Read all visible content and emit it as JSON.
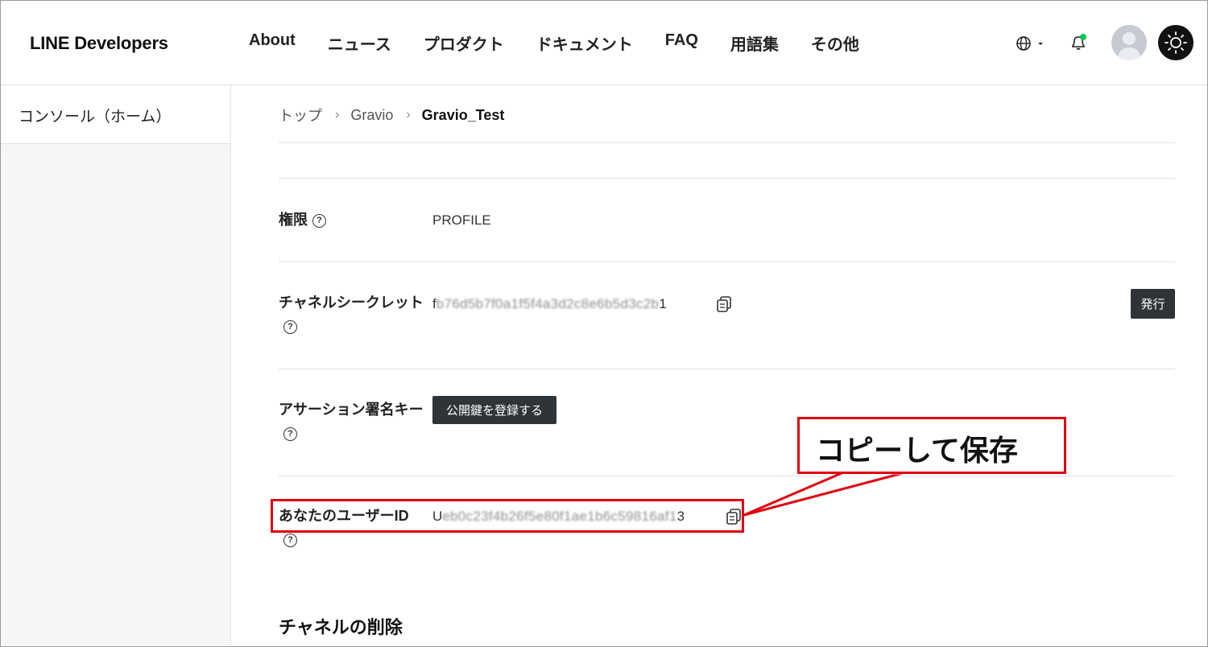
{
  "header": {
    "logo": "LINE Developers",
    "nav": [
      "About",
      "ニュース",
      "プロダクト",
      "ドキュメント",
      "FAQ",
      "用語集",
      "その他"
    ]
  },
  "sidebar": {
    "items": [
      {
        "label": "コンソール（ホーム）"
      }
    ]
  },
  "breadcrumb": {
    "items": [
      "トップ",
      "Gravio",
      "Gravio_Test"
    ]
  },
  "settings": {
    "permission": {
      "label": "権限",
      "value": "PROFILE"
    },
    "channel_secret": {
      "label": "チャネルシークレット",
      "value_start": "f",
      "value_masked": "b76d5b7f0a1f5f4a3d2c8e6b5d3c2b",
      "value_end": "1",
      "button": "発行"
    },
    "assertion_key": {
      "label": "アサーション署名キー",
      "button": "公開鍵を登録する"
    },
    "user_id": {
      "label": "あなたのユーザーID",
      "value_start": "U",
      "value_masked": "eb0c23f4b26f5e80f1ae1b6c59816af1",
      "value_end": "3"
    }
  },
  "section": {
    "delete_title": "チャネルの削除"
  },
  "annotation": {
    "callout": "コピーして保存",
    "color": "#e00012"
  },
  "icons": {
    "help": "?",
    "globe": "globe-icon",
    "bell": "bell-icon",
    "copy": "copy-icon",
    "theme": "sun-icon"
  }
}
